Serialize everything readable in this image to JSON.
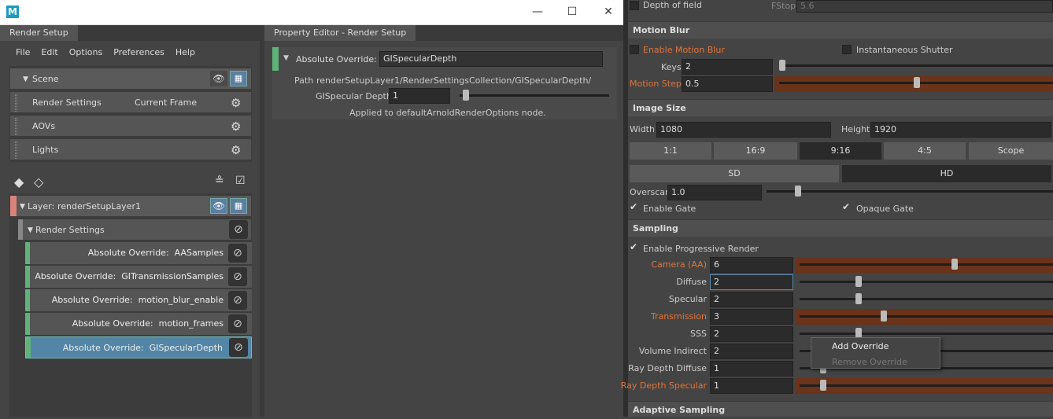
{
  "window": {
    "title_icon": "M",
    "min": "—",
    "max": "☐",
    "close": "✕"
  },
  "left": {
    "tab": "Render Setup",
    "menu": [
      "File",
      "Edit",
      "Options",
      "Preferences",
      "Help"
    ],
    "scene": "Scene",
    "collections": [
      {
        "label": "Render Settings",
        "extra": "Current Frame"
      },
      {
        "label": "AOVs",
        "extra": ""
      },
      {
        "label": "Lights",
        "extra": ""
      }
    ],
    "layer_prefix": "Layer:",
    "layer_name": "renderSetupLayer1",
    "render_settings": "Render Settings",
    "overrides": [
      {
        "label": "Absolute Override:",
        "value": "AASamples"
      },
      {
        "label": "Absolute Override:",
        "value": "GITransmissionSamples"
      },
      {
        "label": "Absolute Override:",
        "value": "motion_blur_enable"
      },
      {
        "label": "Absolute Override:",
        "value": "motion_frames"
      },
      {
        "label": "Absolute Override:",
        "value": "GISpecularDepth"
      }
    ]
  },
  "prop": {
    "tab": "Property Editor - Render Setup",
    "override_label": "Absolute Override:",
    "override_value": "GISpecularDepth",
    "path_label": "Path",
    "path_value": "renderSetupLayer1/RenderSettingsCollection/GISpecularDepth/",
    "attr_label": "GISpecular Depth",
    "attr_value": "1",
    "applied": "Applied to defaultArnoldRenderOptions node."
  },
  "right": {
    "dof_label": "Depth of field",
    "fstop_label": "FStop",
    "fstop_value": "5.6",
    "motion_blur": "Motion Blur",
    "enable_mb": "Enable Motion Blur",
    "inst_shutter": "Instantaneous Shutter",
    "keys_label": "Keys",
    "keys_value": "2",
    "motion_step_label": "Motion Step",
    "motion_step_value": "0.5",
    "image_size": "Image Size",
    "width_label": "Width",
    "width_value": "1080",
    "height_label": "Height",
    "height_value": "1920",
    "ratios": [
      "1:1",
      "16:9",
      "9:16",
      "4:5",
      "Scope"
    ],
    "sd": "SD",
    "hd": "HD",
    "overscan_label": "Overscan",
    "overscan_value": "1.0",
    "enable_gate": "Enable Gate",
    "opaque_gate": "Opaque Gate",
    "sampling": "Sampling",
    "progressive": "Enable Progressive Render",
    "samples": [
      {
        "label": "Camera (AA)",
        "value": "6",
        "orange": true,
        "knob": 0.6
      },
      {
        "label": "Diffuse",
        "value": "2",
        "orange": false,
        "knob": 0.22
      },
      {
        "label": "Specular",
        "value": "2",
        "orange": false,
        "knob": 0.22
      },
      {
        "label": "Transmission",
        "value": "3",
        "orange": true,
        "knob": 0.32
      },
      {
        "label": "SSS",
        "value": "2",
        "orange": false,
        "knob": 0.22
      },
      {
        "label": "Volume Indirect",
        "value": "2",
        "orange": false,
        "knob": 0.1
      },
      {
        "label": "Ray Depth Diffuse",
        "value": "1",
        "orange": false,
        "knob": 0.08
      },
      {
        "label": "Ray Depth Specular",
        "value": "1",
        "orange": true,
        "knob": 0.08
      }
    ],
    "adaptive": "Adaptive Sampling",
    "ctx_add": "Add Override",
    "ctx_remove": "Remove Override"
  }
}
